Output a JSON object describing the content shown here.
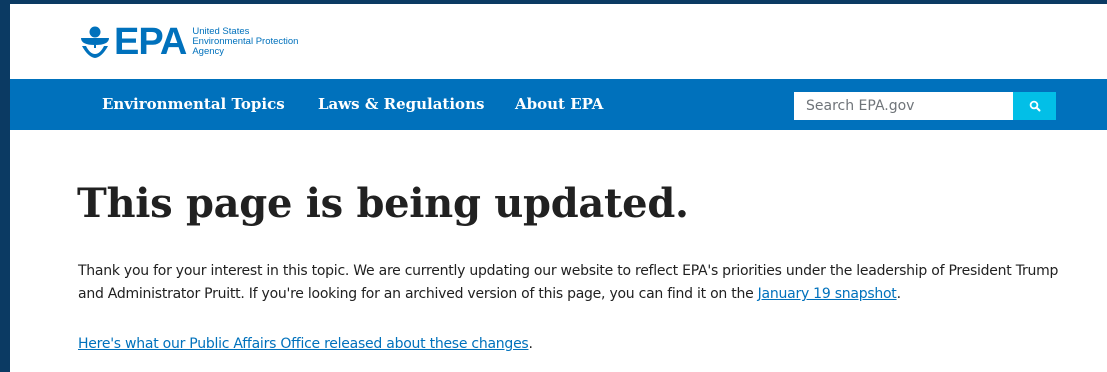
{
  "header": {
    "logo_word": "EPA",
    "logo_lines": [
      "United States",
      "Environmental Protection",
      "Agency"
    ]
  },
  "nav": {
    "items": [
      {
        "label": "Environmental Topics"
      },
      {
        "label": "Laws & Regulations"
      },
      {
        "label": "About EPA"
      }
    ],
    "search": {
      "placeholder": "Search EPA.gov",
      "value": ""
    },
    "search_button_icon": "search-icon"
  },
  "main": {
    "title": "This page is being updated.",
    "paragraph_1": {
      "text": "Thank you for your interest in this topic. We are currently updating our website to reflect EPA's priorities under the leadership of President Trump and Administrator Pruitt. If you're looking for an archived version of this page, you can find it on the ",
      "link": "January 19 snapshot",
      "end": "."
    },
    "paragraph_2": {
      "link": "Here's what our Public Affairs Office released about these changes",
      "end": "."
    }
  },
  "colors": {
    "brand_blue": "#0071bc",
    "search_button": "#02bfe7",
    "text": "#212121",
    "background_edge": "#0b3a63"
  }
}
